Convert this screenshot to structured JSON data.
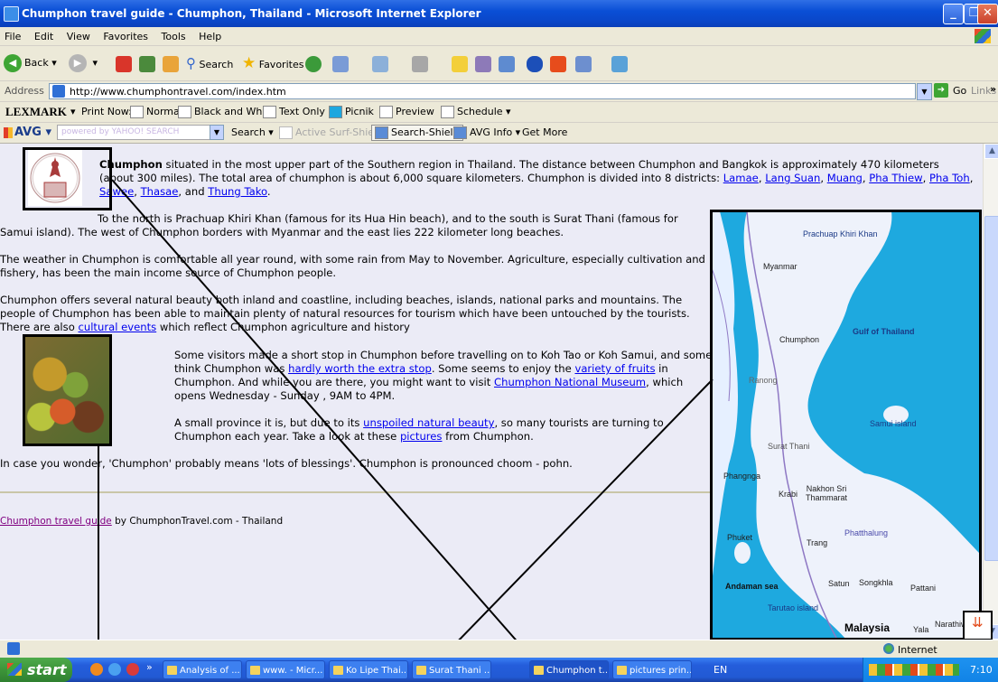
{
  "window": {
    "title": "Chumphon travel guide - Chumphon, Thailand - Microsoft Internet Explorer"
  },
  "menu": [
    "File",
    "Edit",
    "View",
    "Favorites",
    "Tools",
    "Help"
  ],
  "toolbar": {
    "back": "Back",
    "search": "Search",
    "favorites": "Favorites"
  },
  "address": {
    "label": "Address",
    "url": "http://www.chumphontravel.com/index.htm",
    "go": "Go",
    "links": "Links"
  },
  "lexmark": {
    "brand": "LEXMARK",
    "print_now": "Print Now:",
    "normal": "Normal",
    "bw": "Black and White",
    "text_only": "Text Only",
    "picnik": "Picnik",
    "preview": "Preview",
    "schedule": "Schedule"
  },
  "avg": {
    "brand": "AVG",
    "yahoo": "powered by YAHOO! SEARCH",
    "search": "Search",
    "surf": "Active Surf-Shield",
    "shield": "Search-Shield",
    "info": "AVG Info",
    "more": "Get More"
  },
  "content": {
    "p1_bold": "Chumphon",
    "p1_text": " situated in the most upper part of the Southern region in Thailand. The distance between Chumphon and Bangkok is approximately 470 kilometers (about 300 miles). The total area of chumphon is about 6,000 square kilometers. Chumphon is divided into 8 districts: ",
    "districts": [
      "Lamae",
      "Lang Suan",
      "Muang",
      "Pha Thiew",
      "Pha Toh",
      "Sawee",
      "Thasae",
      "Thung Tako"
    ],
    "p2": "To the north is Prachuap Khiri Khan (famous for its Hua Hin beach), and to the south is Surat Thani (famous for Samui island). The west of Chumphon borders with Myanmar and the east lies 222 kilometer long beaches.",
    "p3": "The weather in Chumphon is comfortable all year round, with some rain from May to November. Agriculture, especially cultivation and fishery, has been the main income source of Chumphon people.",
    "p4a": "Chumphon offers several natural beauty both inland and coastline, including beaches, islands, national parks and mountains. The people of Chumphon has been able to maintain plenty of natural resources for tourism which have been untouched by the tourists. There are also ",
    "p4_link": "cultural events",
    "p4b": " which reflect Chumphon agriculture and history",
    "p5a": "Some visitors made a short stop in Chumphon before travelling on to Koh Tao or Koh Samui, and some think Chumphon was ",
    "p5_link1": "hardly worth the extra stop",
    "p5b": ". Some seems to enjoy the ",
    "p5_link2": "variety of fruits",
    "p5c": " in Chumphon. And while you are there, you might want to visit ",
    "p5_link3": "Chumphon National Museum",
    "p5d": ", which opens Wednesday - Sunday , 9AM to 4PM.",
    "p6a": "A small province it is, but due to its ",
    "p6_link1": "unspoiled natural beauty",
    "p6b": ", so many tourists are turning to Chumphon each year. Take a look at these ",
    "p6_link2": "pictures",
    "p6c": " from Chumphon.",
    "p7": "In case you wonder, 'Chumphon' probably means 'lots of blessings'. Chumphon is pronounced choom - pohn.",
    "footer_link": "Chumphon travel guide",
    "footer_text": " by ChumphonTravel.com - Thailand"
  },
  "map": {
    "labels": [
      "Prachuap Khiri Khan",
      "Myanmar",
      "Gulf of Thailand",
      "Chumphon",
      "Ranong",
      "Samui island",
      "Surat Thani",
      "Phangnga",
      "Krabi",
      "Nakhon Sri Thammarat",
      "Phuket",
      "Trang",
      "Phatthalung",
      "Andaman sea",
      "Satun",
      "Songkhla",
      "Pattani",
      "Tarutao island",
      "Malaysia",
      "Yala",
      "Narathiwat"
    ]
  },
  "status": {
    "zone": "Internet"
  },
  "taskbar": {
    "start": "start",
    "tasks": [
      "Analysis of ...",
      "www. - Micr...",
      "Ko Lipe Thai...",
      "Surat Thani ...",
      "Chumphon t...",
      "pictures prin..."
    ],
    "lang": "EN",
    "clock": "7:10"
  }
}
